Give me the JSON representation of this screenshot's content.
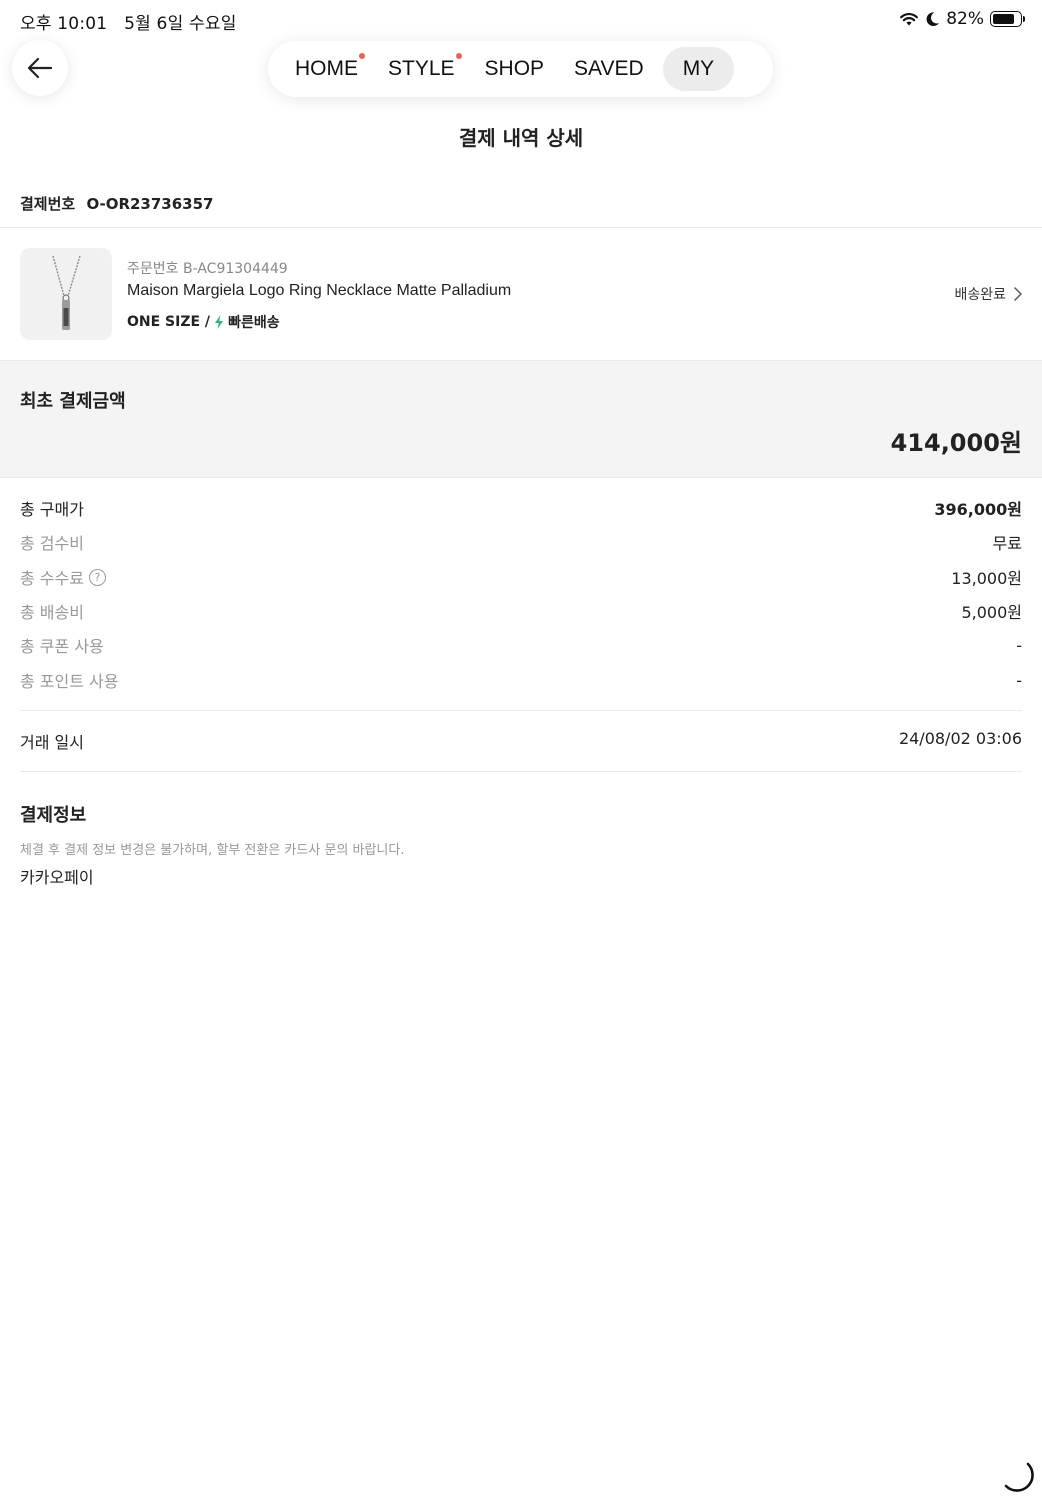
{
  "status_bar": {
    "time": "오후 10:01",
    "date": "5월 6일 수요일",
    "battery": "82%",
    "battery_level": 0.82
  },
  "nav": {
    "back_icon": "arrow-left-icon",
    "tabs": [
      {
        "label": "HOME",
        "dot": true
      },
      {
        "label": "STYLE",
        "dot": true
      },
      {
        "label": "SHOP",
        "dot": false
      },
      {
        "label": "SAVED",
        "dot": false
      },
      {
        "label": "MY",
        "dot": false,
        "active": true
      }
    ],
    "dot_color": "#ef6253"
  },
  "page": {
    "title": "결제 내역 상세"
  },
  "payment": {
    "number_label": "결제번호",
    "number": "O-OR23736357"
  },
  "product": {
    "order_label": "주문번호",
    "order_number": "B-AC91304449",
    "name": "Maison Margiela Logo Ring Necklace Matte Palladium",
    "size": "ONE SIZE /",
    "fast_delivery": "빠른배송",
    "fast_color": "#31b46e",
    "status": "배송완료"
  },
  "total": {
    "label": "최초 결제금액",
    "value": "414,000원"
  },
  "fees": {
    "purchase": {
      "label": "총 구매가",
      "value": "396,000원"
    },
    "inspection": {
      "label": "총 검수비",
      "value": "무료"
    },
    "commission": {
      "label": "총 수수료",
      "value": "13,000원"
    },
    "shipping": {
      "label": "총 배송비",
      "value": "5,000원"
    },
    "coupon": {
      "label": "총 쿠폰 사용",
      "value": "-"
    },
    "points": {
      "label": "총 포인트 사용",
      "value": "-"
    }
  },
  "transaction": {
    "label": "거래 일시",
    "value": "24/08/02 03:06"
  },
  "payment_info": {
    "title": "결제정보",
    "note": "체결 후 결제 정보 변경은 불가하며, 할부 전환은 카드사 문의 바랍니다.",
    "method": "카카오페이"
  }
}
